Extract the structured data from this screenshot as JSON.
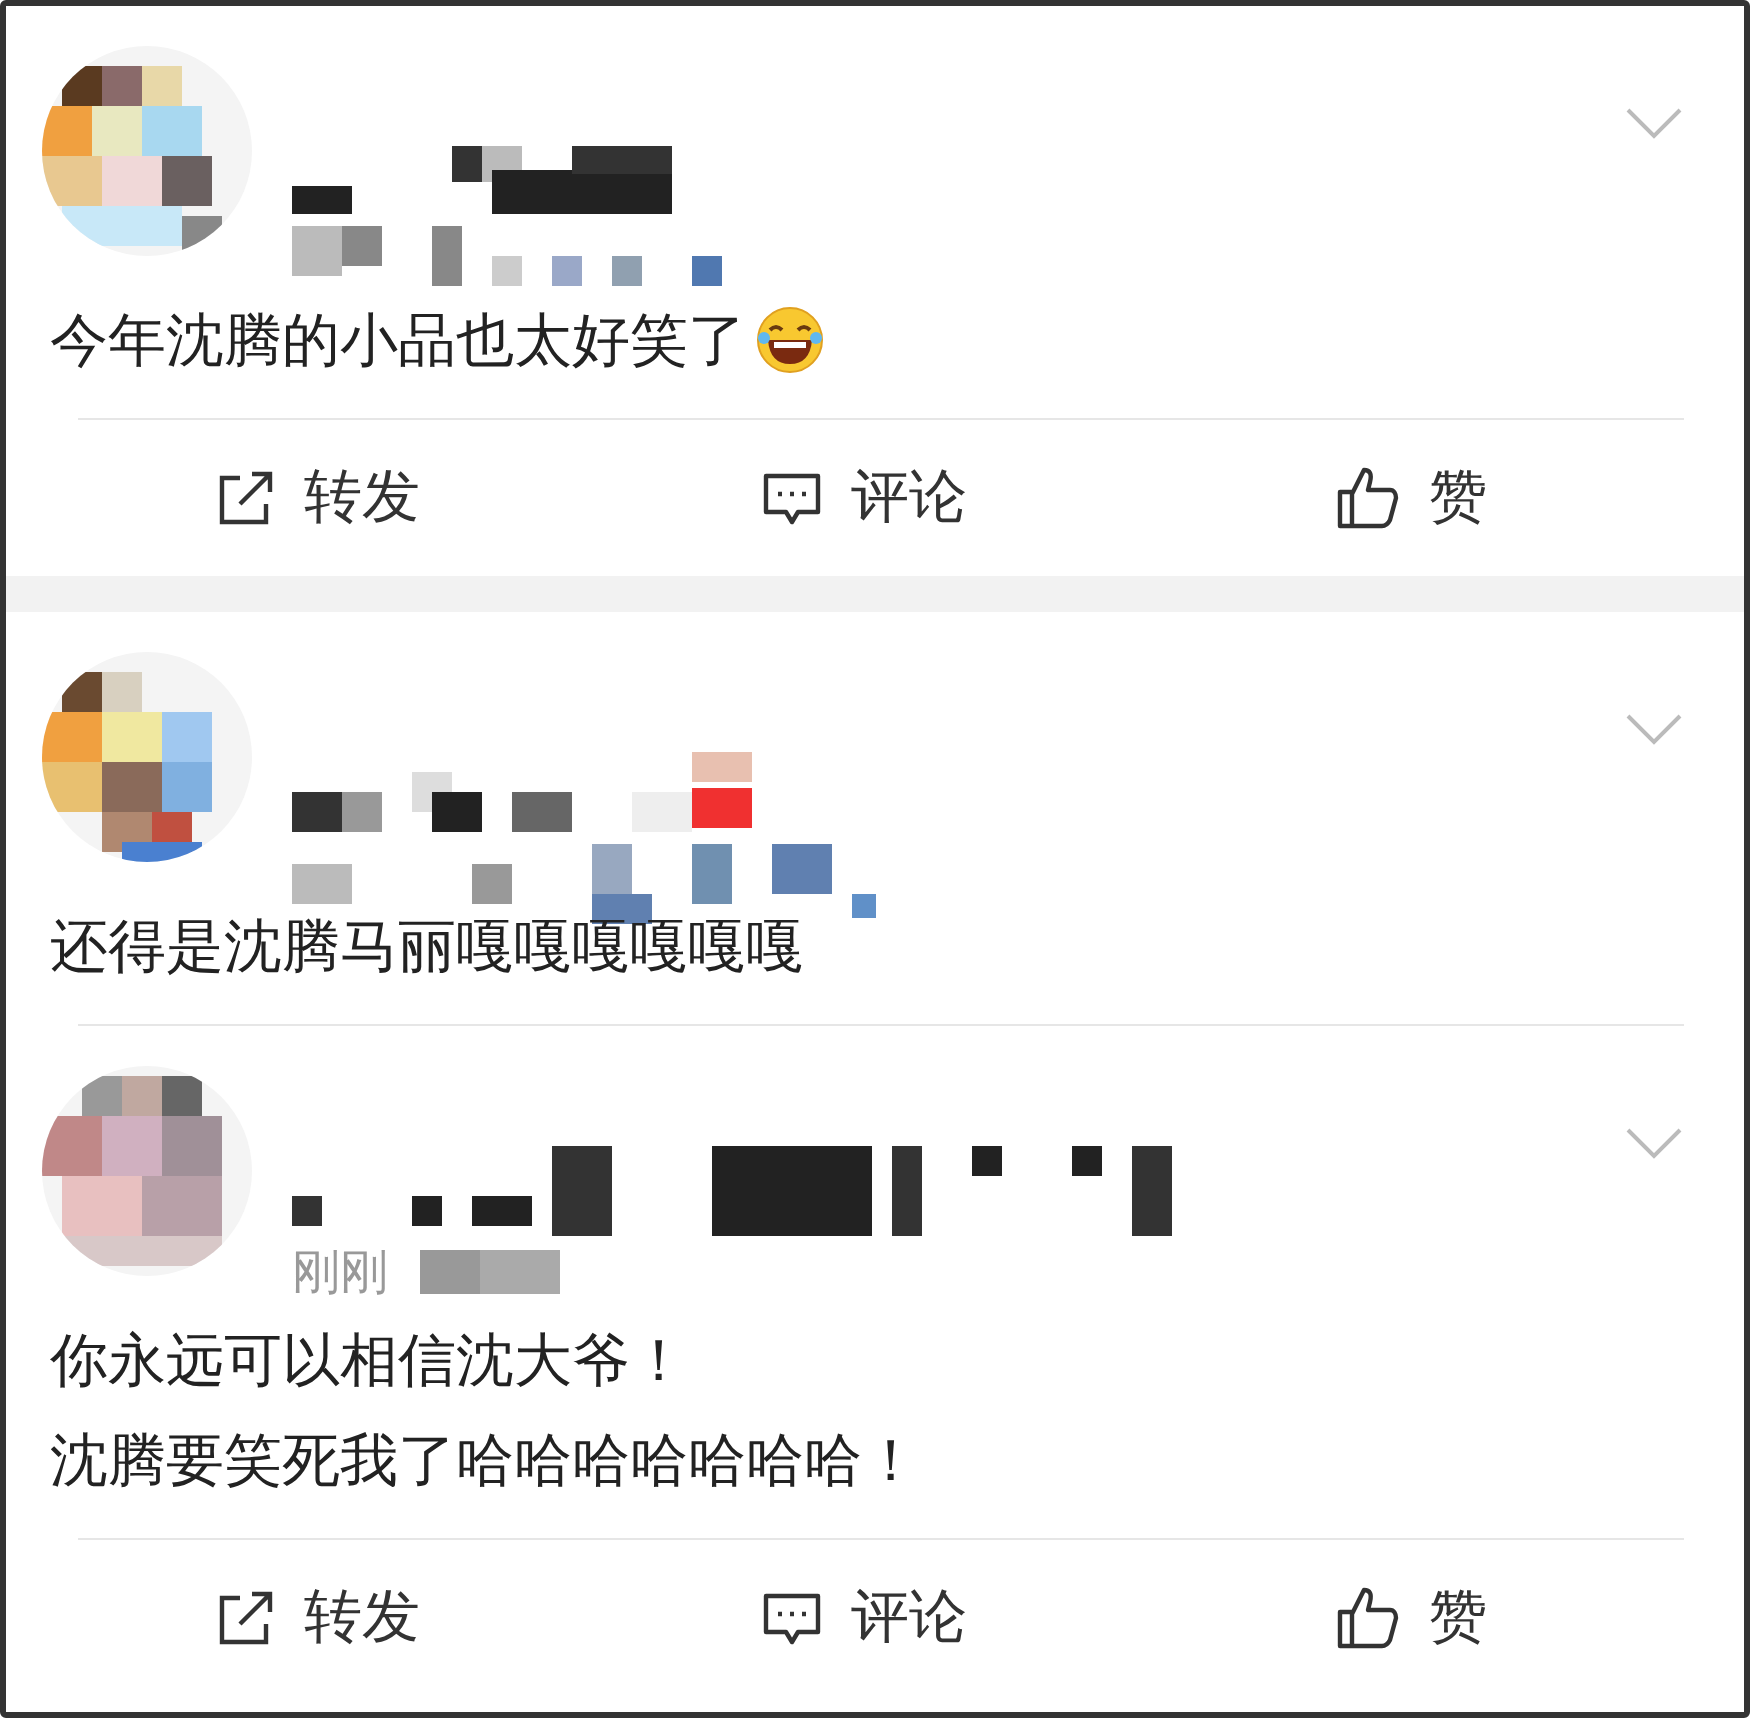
{
  "posts": [
    {
      "lines": [
        "今年沈腾的小品也太好笑了"
      ],
      "emoji": true,
      "actions": [
        {
          "kind": "repost",
          "label": "转发"
        },
        {
          "kind": "comment",
          "label": "评论"
        },
        {
          "kind": "like",
          "label": "赞"
        }
      ]
    },
    {
      "lines": [
        "还得是沈腾马丽嘎嘎嘎嘎嘎嘎"
      ],
      "emoji": false
    },
    {
      "time": "刚刚",
      "lines": [
        "你永远可以相信沈大爷！",
        "沈腾要笑死我了哈哈哈哈哈哈哈！"
      ],
      "emoji": false,
      "actions": [
        {
          "kind": "repost",
          "label": "转发"
        },
        {
          "kind": "comment",
          "label": "评论"
        },
        {
          "kind": "like",
          "label": "赞"
        }
      ]
    }
  ]
}
